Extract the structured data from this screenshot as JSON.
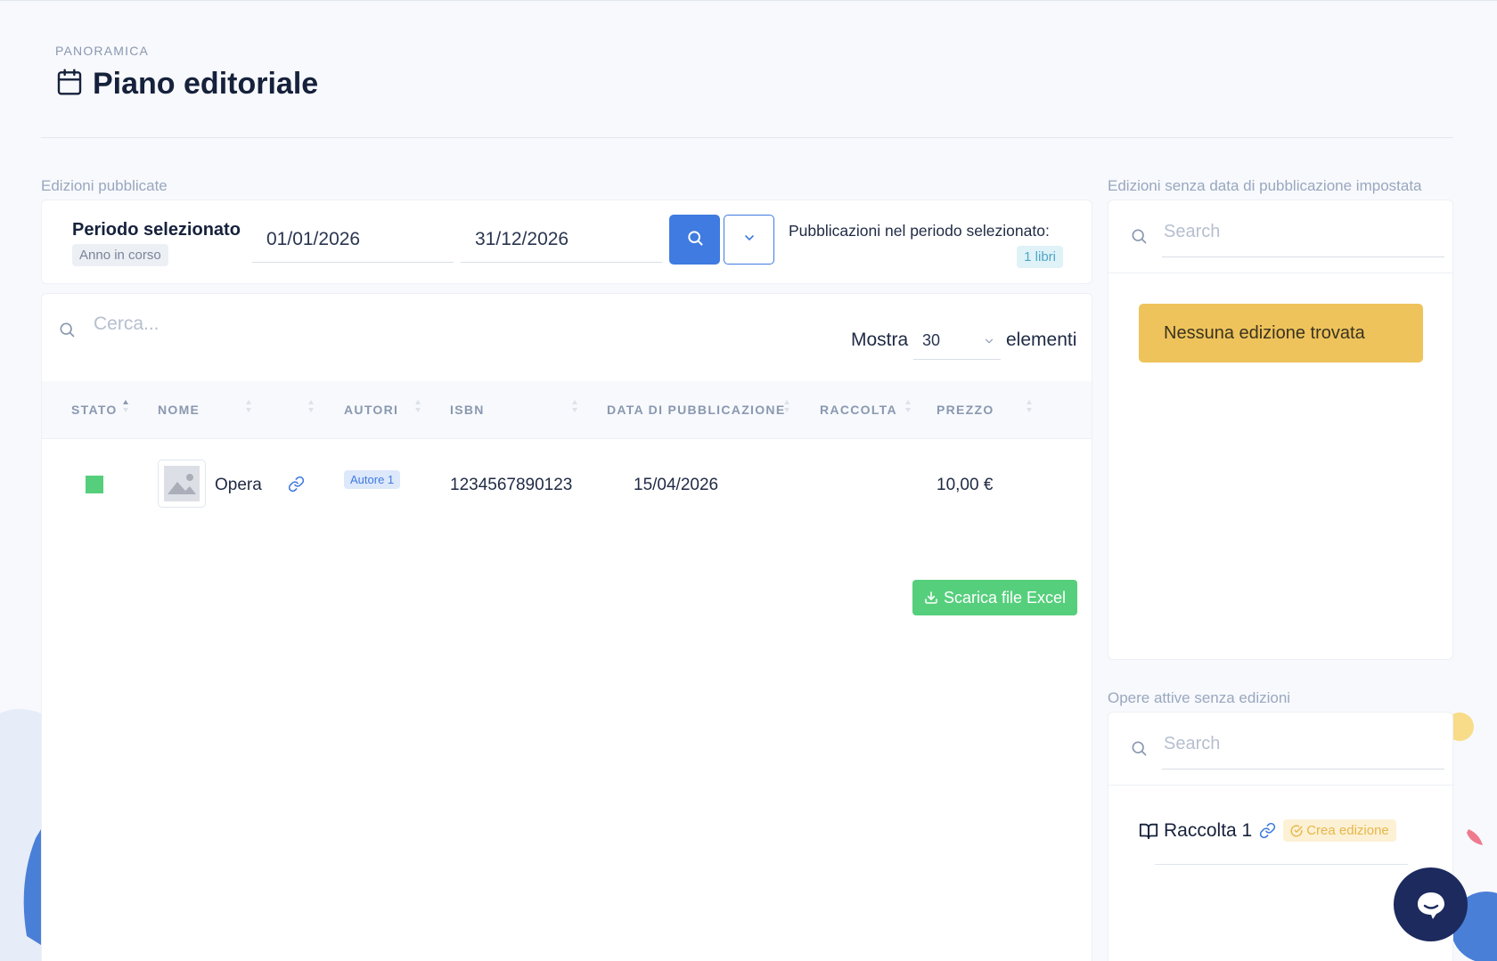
{
  "header": {
    "breadcrumb": "PANORAMICA",
    "title": "Piano editoriale",
    "title_icon": "calendar-icon"
  },
  "published": {
    "section_label": "Edizioni pubblicate",
    "period": {
      "title": "Periodo selezionato",
      "badge": "Anno in corso",
      "date_from": "01/01/2026",
      "date_to": "31/12/2026",
      "pub_label": "Pubblicazioni nel periodo selezionato:",
      "pub_count": "1 libri"
    },
    "table": {
      "search_placeholder": "Cerca...",
      "show_label": "Mostra",
      "show_value": "30",
      "elements_label": "elementi",
      "columns": [
        "STATO",
        "NOME",
        "AUTORI",
        "ISBN",
        "DATA DI PUBBLICAZIONE",
        "RACCOLTA",
        "PREZZO"
      ],
      "rows": [
        {
          "status_color": "#56cf7c",
          "name": "Opera",
          "author": "Autore 1",
          "isbn": "1234567890123",
          "date": "15/04/2026",
          "collection": "",
          "price": "10,00 €"
        }
      ],
      "export_label": "Scarica file Excel"
    }
  },
  "no_date": {
    "section_label": "Edizioni senza data di pubblicazione impostata",
    "search_placeholder": "Search",
    "empty_message": "Nessuna edizione trovata"
  },
  "no_editions": {
    "section_label": "Opere attive senza edizioni",
    "search_placeholder": "Search",
    "items": [
      {
        "label": "Raccolta 1",
        "action": "Crea edizione"
      }
    ]
  },
  "colors": {
    "accent": "#3f7be0",
    "success": "#56cf7c",
    "warning": "#eec35b",
    "chat": "#1c2a5e"
  }
}
